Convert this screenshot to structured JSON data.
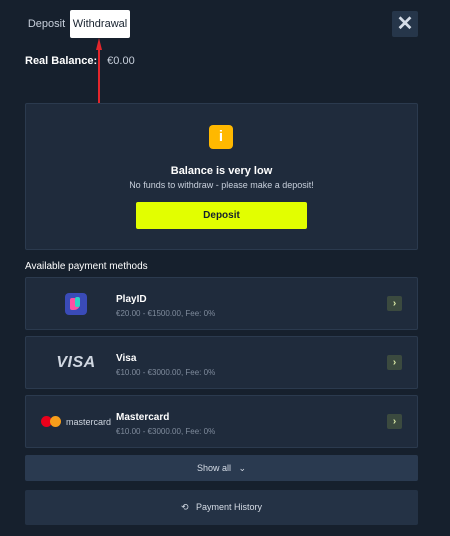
{
  "tabs": [
    {
      "label": "Deposit",
      "active": false
    },
    {
      "label": "Withdrawal",
      "active": true
    }
  ],
  "close_icon": "close-icon",
  "balance": {
    "label": "Real Balance:",
    "value": "€0.00"
  },
  "notice": {
    "icon": "info-icon",
    "icon_glyph": "i",
    "title": "Balance is very low",
    "subtitle": "No funds to withdraw - please make a deposit!",
    "button_label": "Deposit",
    "accent": "#e2ff00"
  },
  "methods_heading": "Available payment methods",
  "methods": [
    {
      "name": "PlayID",
      "range": "€20.00 - €1500.00, Fee: 0%",
      "logo": "playid-logo"
    },
    {
      "name": "Visa",
      "range": "€10.00 - €3000.00, Fee: 0%",
      "logo": "visa-logo",
      "logo_text": "VISA"
    },
    {
      "name": "Mastercard",
      "range": "€10.00 - €3000.00, Fee: 0%",
      "logo": "mastercard-logo",
      "logo_text": "mastercard"
    }
  ],
  "show_all_label": "Show all",
  "history_label": "Payment History",
  "colors": {
    "background": "#16202d",
    "card": "#1f2b3c",
    "warning": "#ffb800",
    "arrow": "#e3262c"
  }
}
